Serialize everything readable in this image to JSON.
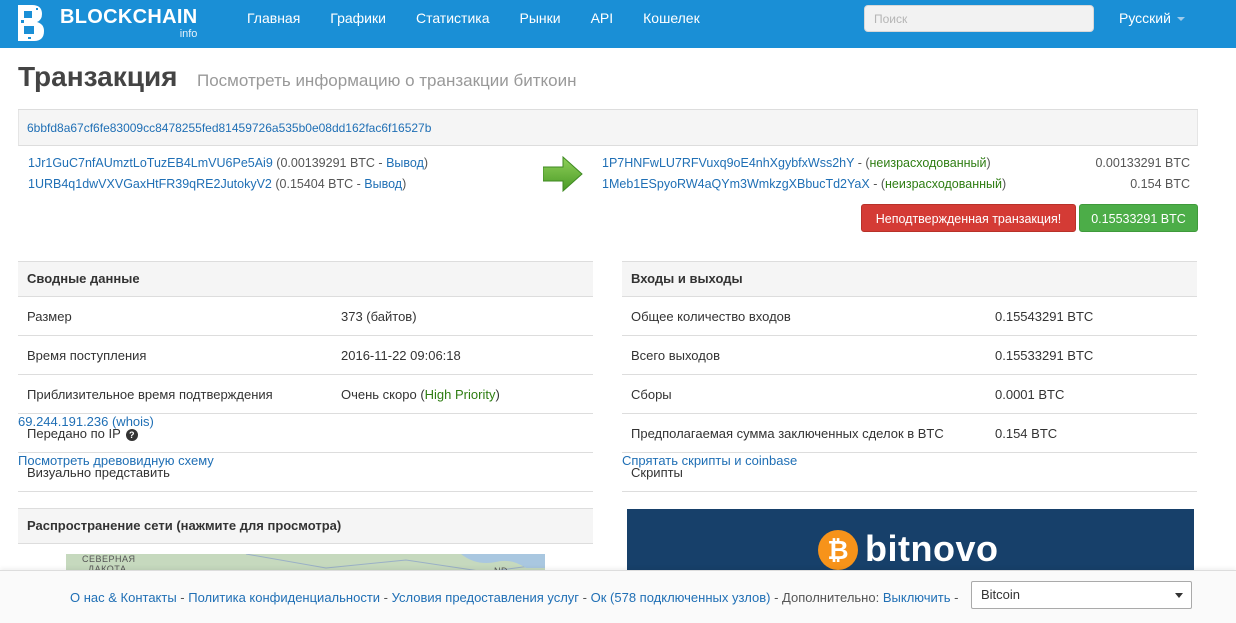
{
  "nav": {
    "brand": "BLOCKCHAIN",
    "brand_sub": "info",
    "links": [
      "Главная",
      "Графики",
      "Статистика",
      "Рынки",
      "API",
      "Кошелек"
    ],
    "search_placeholder": "Поиск",
    "language": "Русский"
  },
  "page": {
    "title": "Транзакция",
    "subtitle": "Посмотреть информацию о транзакции биткоин"
  },
  "tx": {
    "hash": "6bbfd8a67cf6fe83009cc8478255fed81459726a535b0e08dd162fac6f16527b",
    "inputs": [
      {
        "address": "1Jr1GuC7nfAUmztLoTuzEB4LmVU6Pe5Ai9",
        "amount": "(0.00139291 BTC - ",
        "link": "Вывод",
        "close": ")"
      },
      {
        "address": "1URB4q1dwVXVGaxHtFR39qRE2JutokyV2",
        "amount": "(0.15404 BTC - ",
        "link": "Вывод",
        "close": ")"
      }
    ],
    "outputs": [
      {
        "address": "1P7HNFwLU7RFVuxq9oE4nhXgybfxWss2hY",
        "sep": " - (",
        "status": "неизрасходованный",
        "close": ")",
        "value": "0.00133291 BTC"
      },
      {
        "address": "1Meb1ESpyoRW4aQYm3WmkzgXBbucTd2YaX",
        "sep": " - (",
        "status": "неизрасходованный",
        "close": ")",
        "value": "0.154 BTC"
      }
    ],
    "unconfirmed_label": "Неподтвержденная транзакция!",
    "total_label": "0.15533291 BTC"
  },
  "summary": {
    "title": "Сводные данные",
    "rows": {
      "size_k": "Размер",
      "size_v": "373 (байтов)",
      "time_k": "Время поступления",
      "time_v": "2016-11-22 09:06:18",
      "conf_k": "Приблизительное время подтверждения",
      "conf_v": "Очень скоро (",
      "conf_prio": "High Priority",
      "conf_close": ")",
      "ip_k": "Передано по IP",
      "ip_v": "69.244.191.236 (whois)",
      "vis_k": "Визуально представить",
      "vis_v": "Посмотреть древовидную схему"
    }
  },
  "io": {
    "title": "Входы и выходы",
    "rows": {
      "in_k": "Общее количество входов",
      "in_v": "0.15543291 BTC",
      "out_k": "Всего выходов",
      "out_v": "0.15533291 BTC",
      "fee_k": "Сборы",
      "fee_v": "0.0001 BTC",
      "est_k": "Предполагаемая сумма заключенных сделок в BTC",
      "est_v": "0.154 BTC",
      "scr_k": "Скрипты",
      "scr_v": "Спрятать скрипты и coinbase"
    }
  },
  "network": {
    "title": "Распространение сети (нажмите для просмотра)",
    "map_label_1": "СЕВЕРНАЯ",
    "map_label_2": "ДАКОТА",
    "map_label_3": "ND"
  },
  "ad": {
    "coin_symbol": "₿",
    "text": "bitnovo"
  },
  "footer": {
    "about": "О нас & Контакты",
    "privacy": "Политика конфиденциальности",
    "terms": "Условия предоставления услуг",
    "ok": "Ок",
    "nodes": "(578 подключенных узлов)",
    "extra_label": "Дополнительно:",
    "disable": "Выключить",
    "currency": "Bitcoin"
  },
  "colors": {
    "navbar": "#1a8fd6",
    "unconfirmed": "#d43b35",
    "total": "#4cad48",
    "unspent": "#2e7d12",
    "ad_bg": "#17406a",
    "ad_coin": "#f7931a"
  }
}
